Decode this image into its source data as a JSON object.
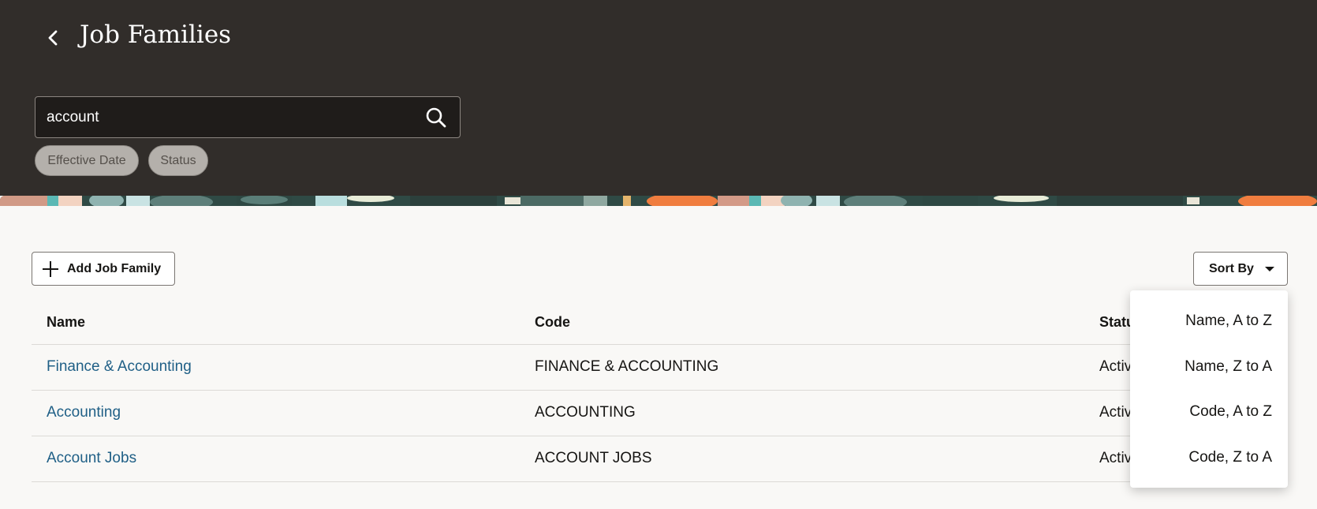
{
  "header": {
    "title": "Job Families",
    "back_icon": "chevron-left-icon"
  },
  "search": {
    "value": "account",
    "icon": "search-icon"
  },
  "filters": [
    {
      "label": "Effective Date"
    },
    {
      "label": "Status"
    }
  ],
  "toolbar": {
    "add_label": "Add Job Family",
    "add_icon": "plus-icon",
    "sort_label": "Sort By",
    "sort_icon": "caret-down-icon"
  },
  "table": {
    "columns": [
      "Name",
      "Code",
      "Status"
    ],
    "rows": [
      {
        "name": "Finance & Accounting",
        "code": "FINANCE & ACCOUNTING",
        "status": "Active"
      },
      {
        "name": "Accounting",
        "code": "ACCOUNTING",
        "status": "Active"
      },
      {
        "name": "Account Jobs",
        "code": "ACCOUNT JOBS",
        "status": "Active"
      }
    ]
  },
  "sort_menu": {
    "items": [
      "Name, A to Z",
      "Name, Z to A",
      "Code, A to Z",
      "Code, Z to A"
    ]
  },
  "colors": {
    "header_bg": "#312d2a",
    "link": "#1f5f86",
    "chip_bg": "#b4b0ab"
  }
}
